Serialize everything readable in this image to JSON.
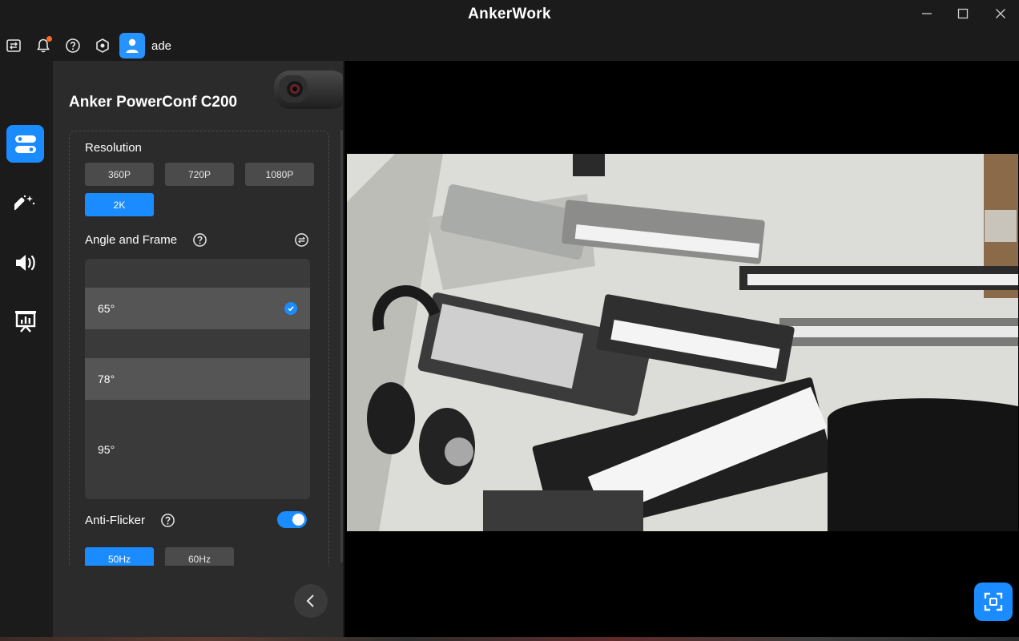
{
  "window": {
    "title": "AnkerWork"
  },
  "toolbar": {
    "username": "ade"
  },
  "device": {
    "name": "Anker PowerConf C200"
  },
  "resolution": {
    "label": "Resolution",
    "options": [
      "360P",
      "720P",
      "1080P",
      "2K"
    ],
    "selected": "2K"
  },
  "angle": {
    "label": "Angle and Frame",
    "options": [
      "65°",
      "78°",
      "95°"
    ],
    "selected": "65°"
  },
  "anti_flicker": {
    "label": "Anti-Flicker",
    "enabled": true,
    "options": [
      "50Hz",
      "60Hz"
    ],
    "selected": "50Hz"
  },
  "colors": {
    "accent": "#1b8cff",
    "panel_bg": "#2b2b2b",
    "app_bg": "#1b1b1b",
    "notification_dot": "#ff6a21"
  },
  "icons": {
    "titlebar": [
      "minimize-icon",
      "maximize-icon",
      "close-icon"
    ],
    "toolbar": [
      "switch-device-icon",
      "bell-icon",
      "help-icon",
      "settings-hex-icon",
      "user-icon"
    ],
    "nav": [
      "camera-settings-icon",
      "magic-wand-icon",
      "speaker-icon",
      "presentation-icon"
    ],
    "panel": [
      "help-icon",
      "reset-icon",
      "check-icon",
      "chevron-left-icon"
    ],
    "preview": [
      "fullscreen-icon"
    ]
  }
}
